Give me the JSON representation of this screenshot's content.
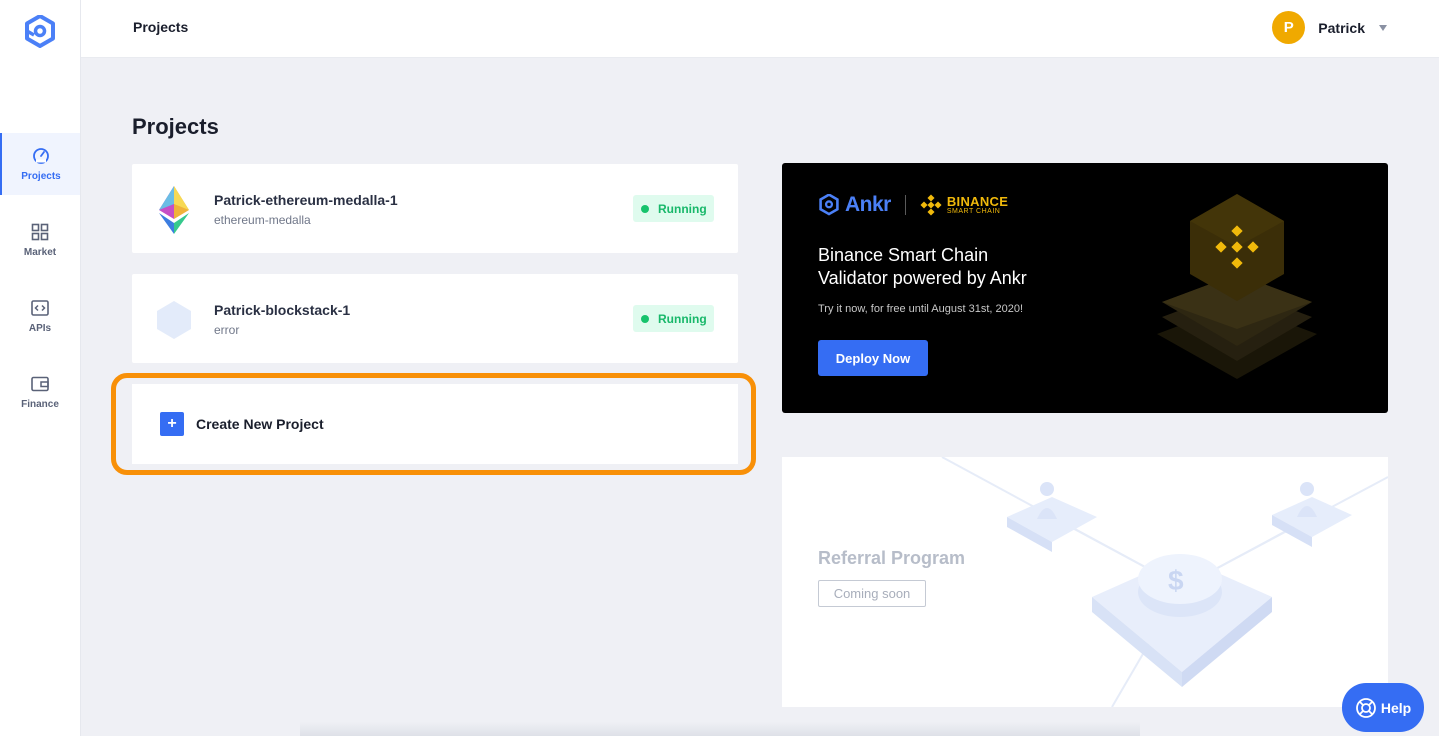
{
  "sidebar": {
    "logo": "ankr-logo-icon",
    "items": [
      {
        "label": "Projects",
        "icon": "speedometer-icon",
        "active": true
      },
      {
        "label": "Market",
        "icon": "grid-icon",
        "active": false
      },
      {
        "label": "APIs",
        "icon": "code-icon",
        "active": false
      },
      {
        "label": "Finance",
        "icon": "wallet-icon",
        "active": false
      }
    ]
  },
  "header": {
    "title": "Projects",
    "user": {
      "initial": "P",
      "name": "Patrick"
    }
  },
  "main": {
    "title": "Projects",
    "projects": [
      {
        "name": "Patrick-ethereum-medalla-1",
        "chain": "ethereum-medalla",
        "status": "Running",
        "icon": "ethereum-icon"
      },
      {
        "name": "Patrick-blockstack-1",
        "chain": "error",
        "status": "Running",
        "icon": "hexagon-icon"
      }
    ],
    "create_label": "Create New Project",
    "create_icon": "+"
  },
  "banner": {
    "ankr": "Ankr",
    "binance_line1": "BINANCE",
    "binance_line2": "SMART CHAIN",
    "title_line1": "Binance Smart Chain",
    "title_line2": "Validator powered by Ankr",
    "subtitle": "Try it now, for free until August 31st, 2020!",
    "button": "Deploy Now"
  },
  "referral": {
    "title": "Referral Program",
    "badge": "Coming soon"
  },
  "help": {
    "label": "Help"
  },
  "colors": {
    "accent": "#356df3",
    "highlight": "#f89008",
    "running": "#16c36c",
    "binance": "#f0b90b",
    "avatar": "#f0a900"
  }
}
